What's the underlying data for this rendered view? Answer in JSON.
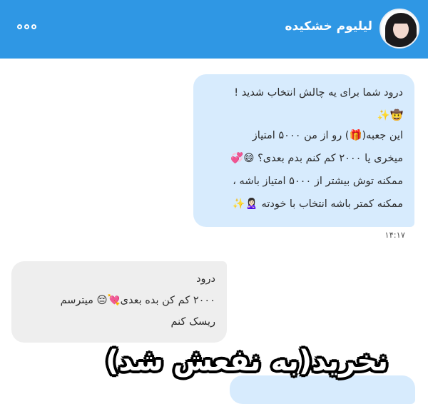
{
  "header": {
    "title": "لیلیوم خشکیده",
    "more_icon": "more-horizontal-icon",
    "avatar_icon": "profile-photo",
    "color": "#2f97e4"
  },
  "messages": [
    {
      "direction": "incoming",
      "lines": [
        "درود شما برای یه چالش انتخاب شدید !",
        "🤠✨",
        "این جعبه(🎁) رو از من ۵۰۰۰ امتیاز",
        "میخری یا ۲۰۰۰ کم کنم بدم بعدی؟ 😄💞",
        "ممکنه توش بیشتر از ۵۰۰۰ امتیاز باشه ،",
        "ممکنه کمتر باشه انتخاب با خودته 🙎🏻‍♀️✨"
      ],
      "time": "۱۴:۱۷",
      "color": "#d7ebfd"
    },
    {
      "direction": "outgoing",
      "lines": [
        "درود",
        "۲۰۰۰ کم کن بده بعدی💘😔 میترسم",
        "ریسک کنم"
      ],
      "color": "#eeeeee"
    }
  ],
  "overlay_caption": "نخرید(به نفعش شد)"
}
